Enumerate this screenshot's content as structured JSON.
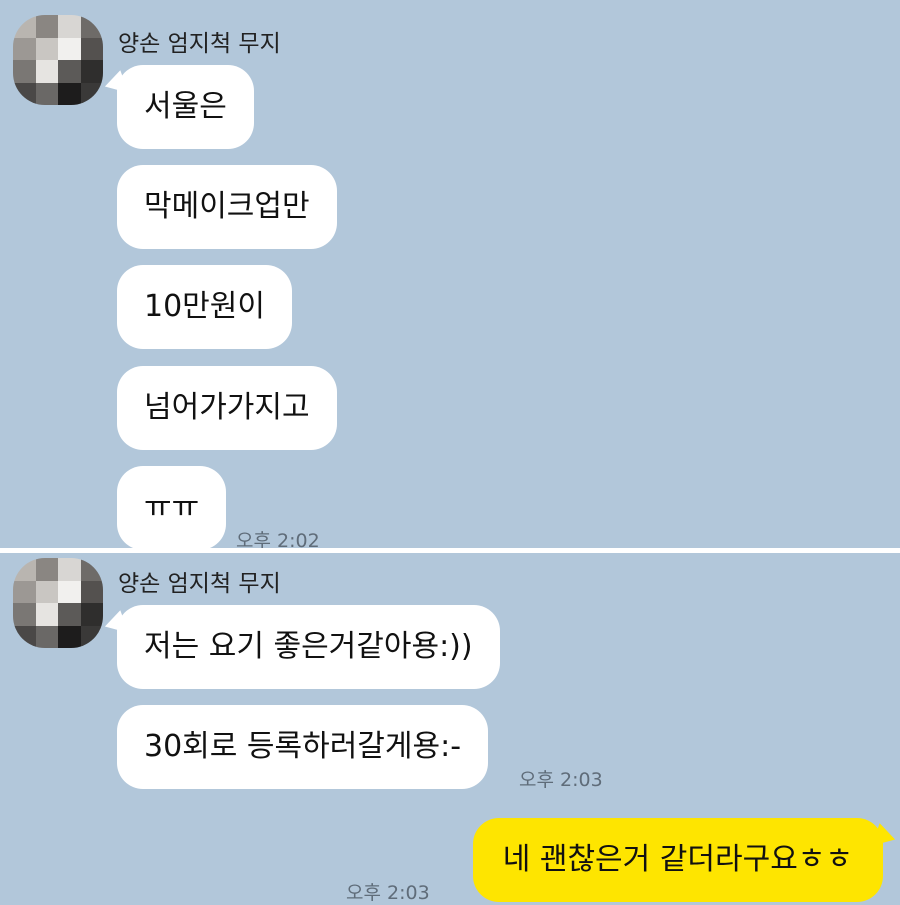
{
  "chat": {
    "sender_name": "양손 엄지척 무지",
    "group1": {
      "messages": [
        "서울은",
        "막메이크업만",
        "10만원이",
        "넘어가가지고",
        "ㅠㅠ"
      ],
      "time": "오후 2:02"
    },
    "group2": {
      "messages": [
        "저는 요기 좋은거같아용:))",
        "30회로 등록하러갈게용:-"
      ],
      "time": "오후 2:03"
    },
    "my_message": {
      "text": "네 괜찮은거 같더라구요ㅎㅎ",
      "time": "오후 2:03"
    }
  },
  "colors": {
    "background": "#b2c7da",
    "incoming_bubble": "#ffffff",
    "outgoing_bubble": "#fee500"
  },
  "icons": {
    "avatar": "blurred-profile-avatar"
  }
}
